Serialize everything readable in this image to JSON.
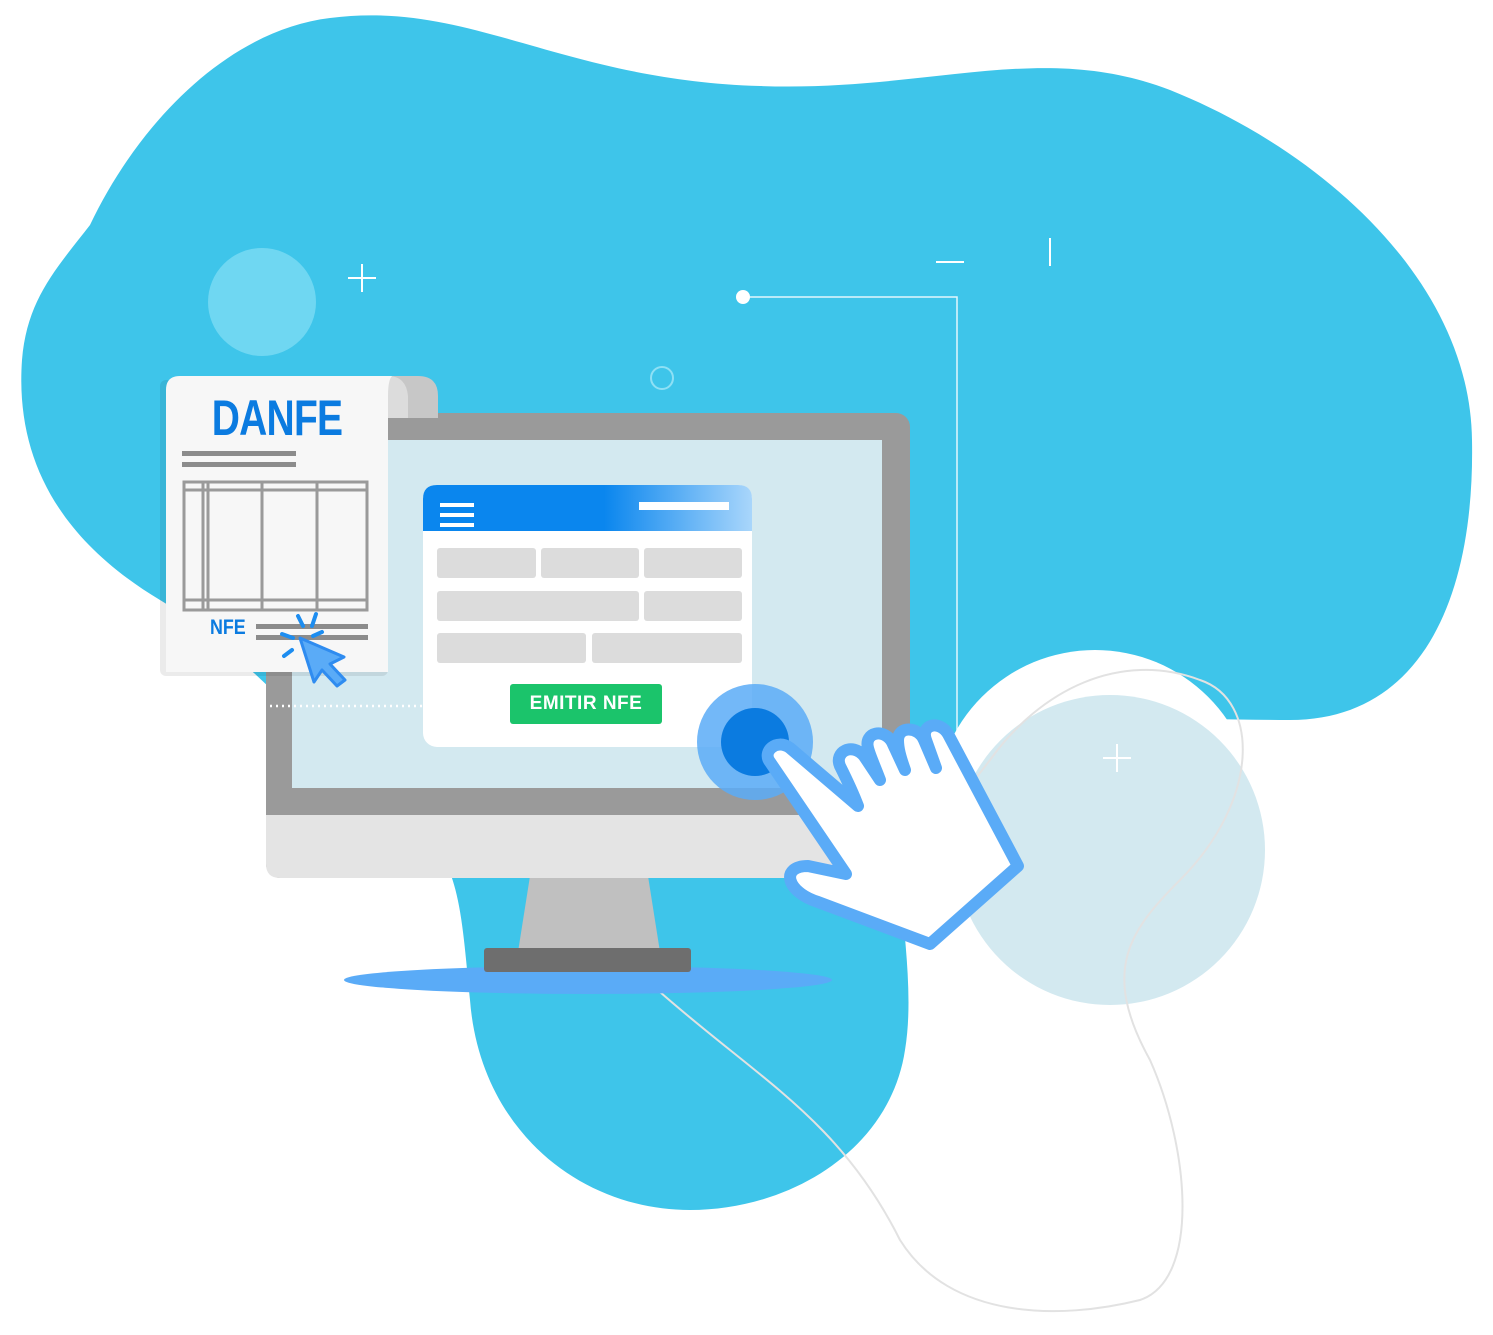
{
  "document": {
    "title": "DANFE",
    "footer_label": "NFE"
  },
  "form_window": {
    "submit_label": "EMITIR NFE"
  },
  "colors": {
    "blob": "#3ec5ea",
    "accent_blue": "#0b7be0",
    "button_green": "#1bc46b",
    "monitor_frame": "#9a9a9a",
    "screen": "#d3e9f0",
    "hand_outline": "#5aabf7"
  },
  "icons": [
    "hamburger-menu-icon",
    "mouse-cursor-icon",
    "pointing-hand-icon",
    "touch-target-icon"
  ]
}
